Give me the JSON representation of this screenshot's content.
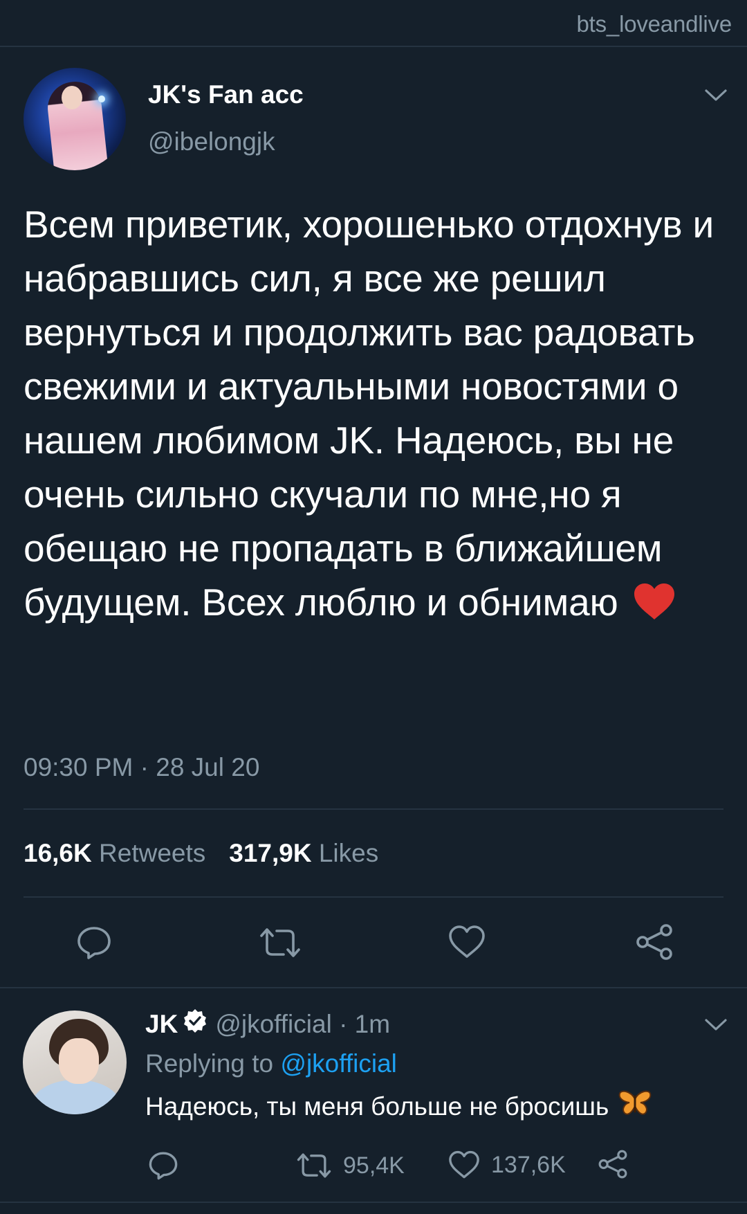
{
  "watermark": "bts_loveandlive",
  "tweet": {
    "author_name": "JK's Fan acc",
    "author_handle": "@ibelongjk",
    "text": "Всем приветик, хорошенько отдохнув и набравшись сил, я все же решил вернуться и продолжить вас радовать свежими и актуальными новостями о нашем любимом JK. Надеюсь, вы не очень сильно скучали по мне,но я обещаю не пропадать в ближайшем будущем. Всех люблю и обнимаю",
    "timestamp": "09:30 PM · 28 Jul 20",
    "retweets_count": "16,6K",
    "retweets_label": "Retweets",
    "likes_count": "317,9K",
    "likes_label": "Likes"
  },
  "reply": {
    "author_name": "JK",
    "author_meta": "@jkofficial · 1m",
    "replying_prefix": "Replying to ",
    "replying_mention": "@jkofficial",
    "text": "Надеюсь, ты меня больше не бросишь",
    "retweets_count": "95,4K",
    "likes_count": "137,6K"
  },
  "colors": {
    "background": "#15202b",
    "secondary_text": "#8899a6",
    "accent": "#1da1f2",
    "divider": "#253341",
    "heart_emoji": "#e0332f"
  },
  "icons": [
    "chevron-down-icon",
    "reply-icon",
    "retweet-icon",
    "like-icon",
    "share-icon",
    "verified-badge-icon",
    "red-heart-emoji",
    "butterfly-emoji"
  ]
}
